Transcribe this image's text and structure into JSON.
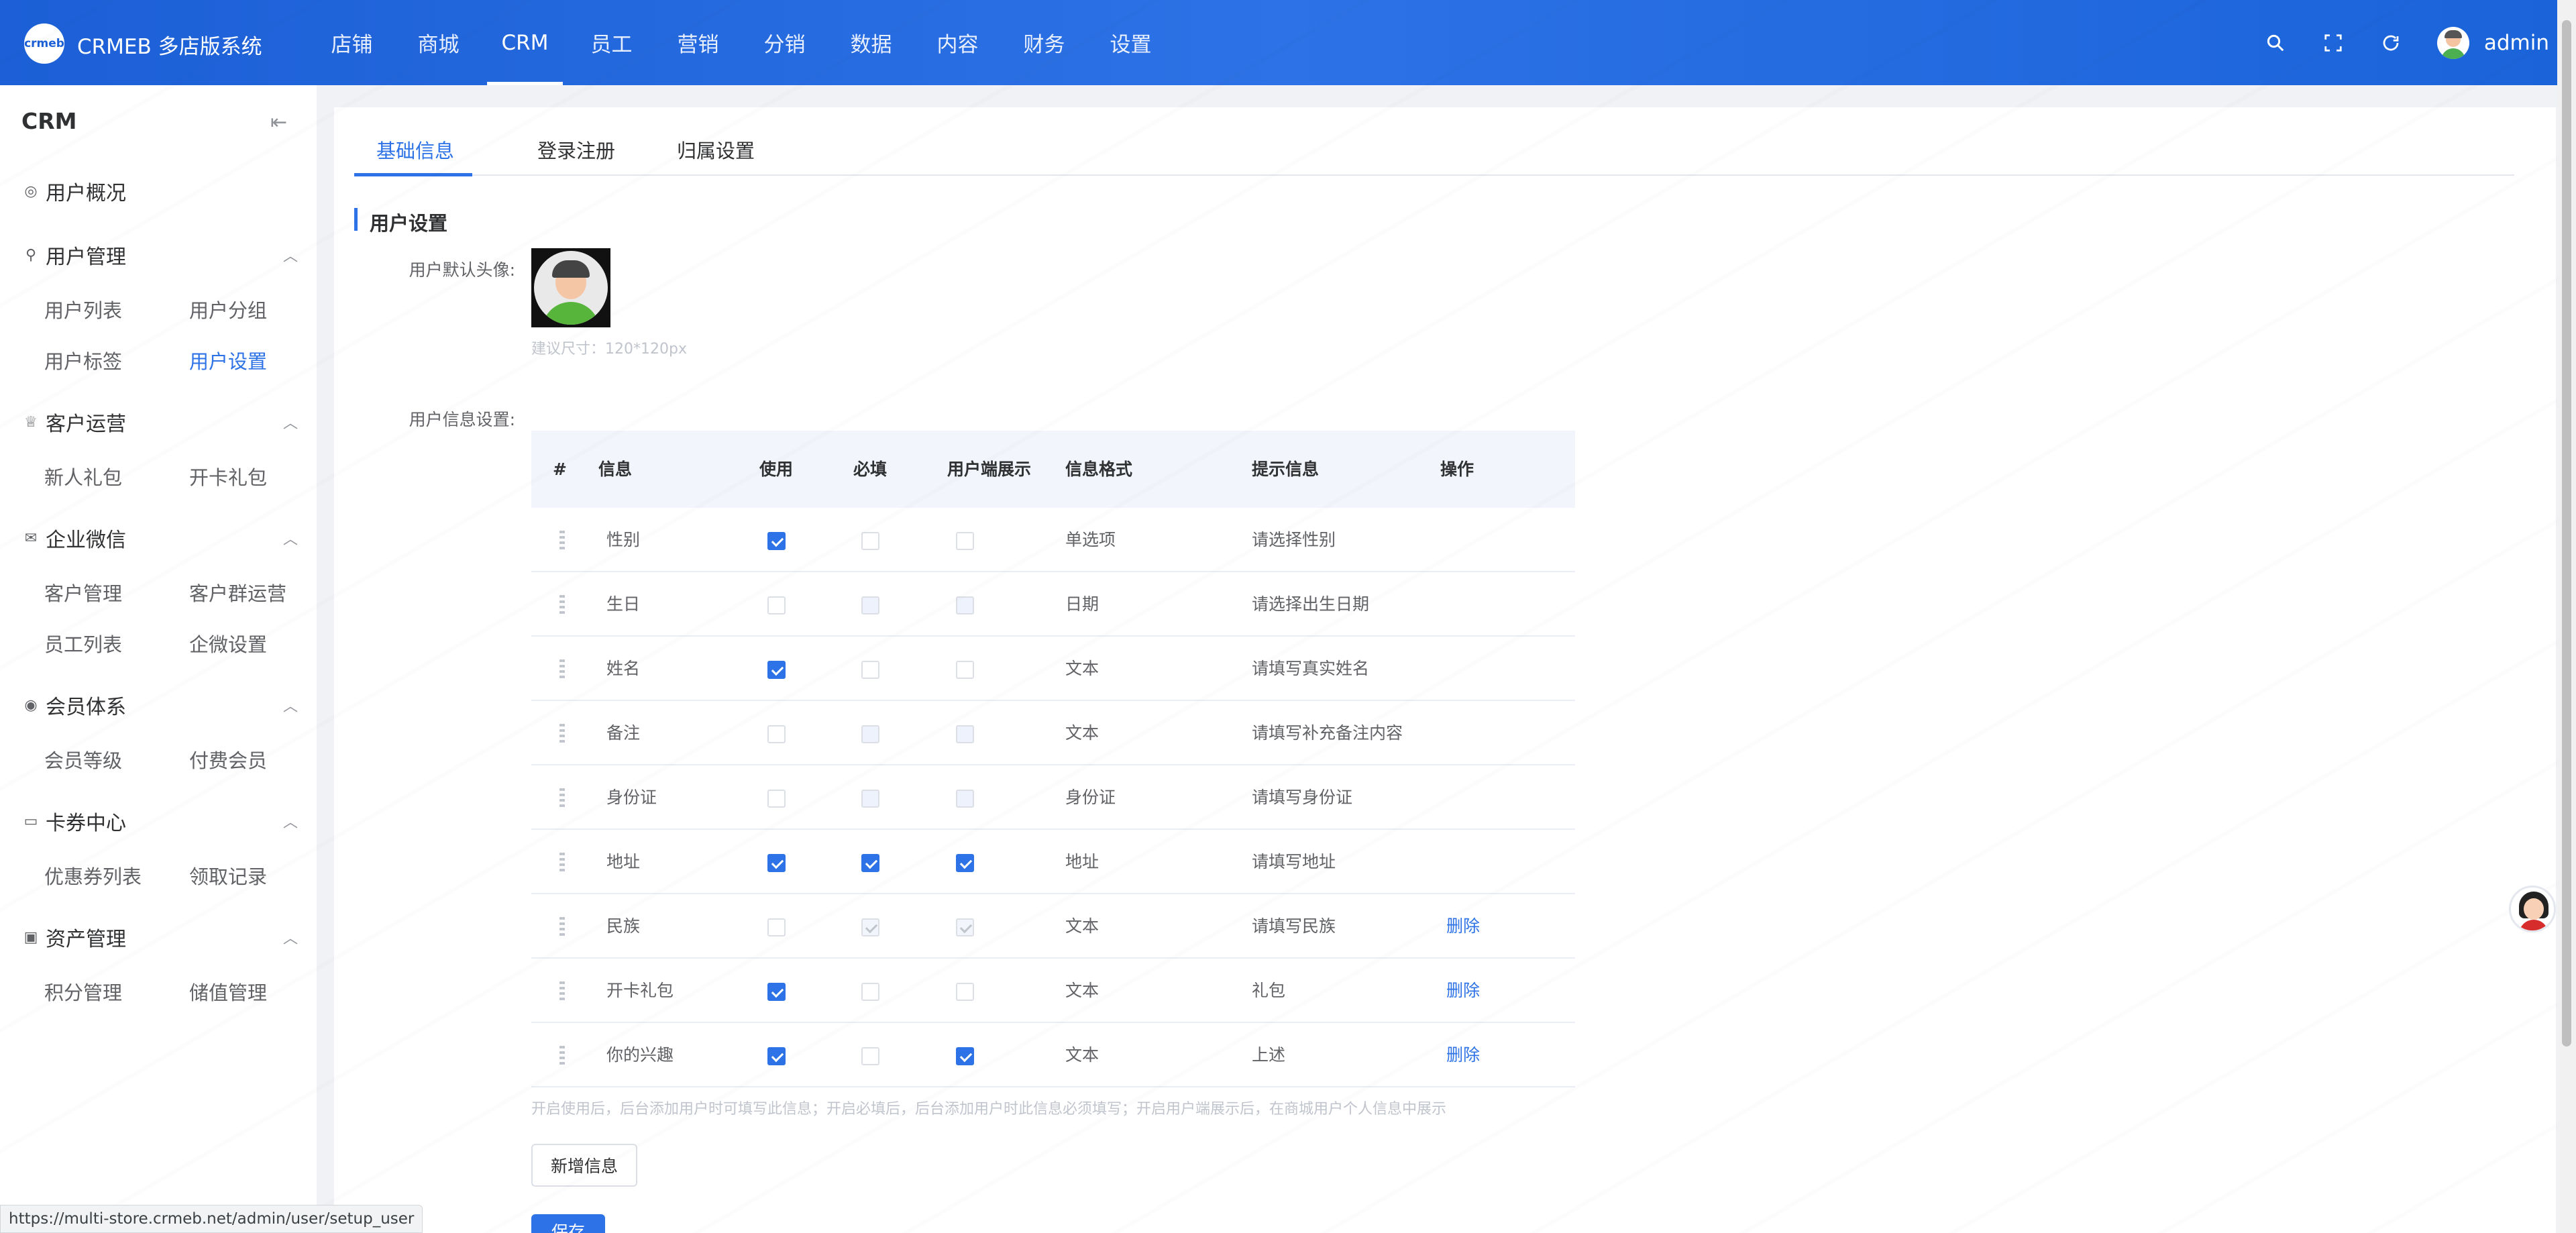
{
  "header": {
    "logo_text": "crmeb",
    "brand": "CRMEB 多店版系统",
    "nav": [
      "店铺",
      "商城",
      "CRM",
      "员工",
      "营销",
      "分销",
      "数据",
      "内容",
      "财务",
      "设置"
    ],
    "active_nav": "CRM",
    "tools": [
      "search-icon",
      "fullscreen-icon",
      "refresh-icon"
    ],
    "username": "admin"
  },
  "sidebar": {
    "title": "CRM",
    "collapse_icon": "collapse-left-icon",
    "overview": "用户概况",
    "groups": [
      {
        "label": "用户管理",
        "icon": "user-icon",
        "items": [
          "用户列表",
          "用户分组",
          "用户标签",
          "用户设置"
        ]
      },
      {
        "label": "客户运营",
        "icon": "trophy-icon",
        "items": [
          "新人礼包",
          "开卡礼包"
        ]
      },
      {
        "label": "企业微信",
        "icon": "chat-icon",
        "items": [
          "客户管理",
          "客户群运营",
          "员工列表",
          "企微设置"
        ]
      },
      {
        "label": "会员体系",
        "icon": "member-icon",
        "items": [
          "会员等级",
          "付费会员"
        ]
      },
      {
        "label": "卡券中心",
        "icon": "card-icon",
        "items": [
          "优惠券列表",
          "领取记录"
        ]
      },
      {
        "label": "资产管理",
        "icon": "wallet-icon",
        "items": [
          "积分管理",
          "储值管理"
        ]
      }
    ],
    "active_item": "用户设置"
  },
  "tabs": [
    "基础信息",
    "登录注册",
    "归属设置"
  ],
  "active_tab": "基础信息",
  "section_title": "用户设置",
  "form": {
    "avatar_label": "用户默认头像:",
    "avatar_hint": "建议尺寸：120*120px",
    "info_label": "用户信息设置:"
  },
  "table": {
    "headers": [
      "#",
      "信息",
      "使用",
      "必填",
      "用户端展示",
      "信息格式",
      "提示信息",
      "操作"
    ],
    "rows": [
      {
        "name": "性别",
        "use": true,
        "required": false,
        "show": false,
        "format": "单选项",
        "hint": "请选择性别",
        "req_disabled": false,
        "show_disabled": false,
        "action": ""
      },
      {
        "name": "生日",
        "use": false,
        "required": false,
        "show": false,
        "format": "日期",
        "hint": "请选择出生日期",
        "req_disabled": true,
        "show_disabled": true,
        "action": ""
      },
      {
        "name": "姓名",
        "use": true,
        "required": false,
        "show": false,
        "format": "文本",
        "hint": "请填写真实姓名",
        "req_disabled": false,
        "show_disabled": false,
        "action": ""
      },
      {
        "name": "备注",
        "use": false,
        "required": false,
        "show": false,
        "format": "文本",
        "hint": "请填写补充备注内容",
        "req_disabled": true,
        "show_disabled": true,
        "action": ""
      },
      {
        "name": "身份证",
        "use": false,
        "required": false,
        "show": false,
        "format": "身份证",
        "hint": "请填写身份证",
        "req_disabled": true,
        "show_disabled": true,
        "action": ""
      },
      {
        "name": "地址",
        "use": true,
        "required": true,
        "show": true,
        "format": "地址",
        "hint": "请填写地址",
        "req_disabled": false,
        "show_disabled": false,
        "action": ""
      },
      {
        "name": "民族",
        "use": false,
        "required": true,
        "show": true,
        "format": "文本",
        "hint": "请填写民族",
        "req_disabled": true,
        "show_disabled": true,
        "action": "删除"
      },
      {
        "name": "开卡礼包",
        "use": true,
        "required": false,
        "show": false,
        "format": "文本",
        "hint": "礼包",
        "req_disabled": false,
        "show_disabled": false,
        "action": "删除"
      },
      {
        "name": "你的兴趣",
        "use": true,
        "required": false,
        "show": true,
        "format": "文本",
        "hint": "上述",
        "req_disabled": false,
        "show_disabled": false,
        "action": "删除"
      }
    ]
  },
  "note": "开启使用后，后台添加用户时可填写此信息；开启必填后，后台添加用户时此信息必须填写；开启用户端展示后，在商城用户个人信息中展示",
  "add_button": "新增信息",
  "save_button": "保存",
  "status_url": "https://multi-store.crmeb.net/admin/user/setup_user",
  "colors": {
    "primary": "#2d72e6",
    "header": "#1c5fd6"
  }
}
